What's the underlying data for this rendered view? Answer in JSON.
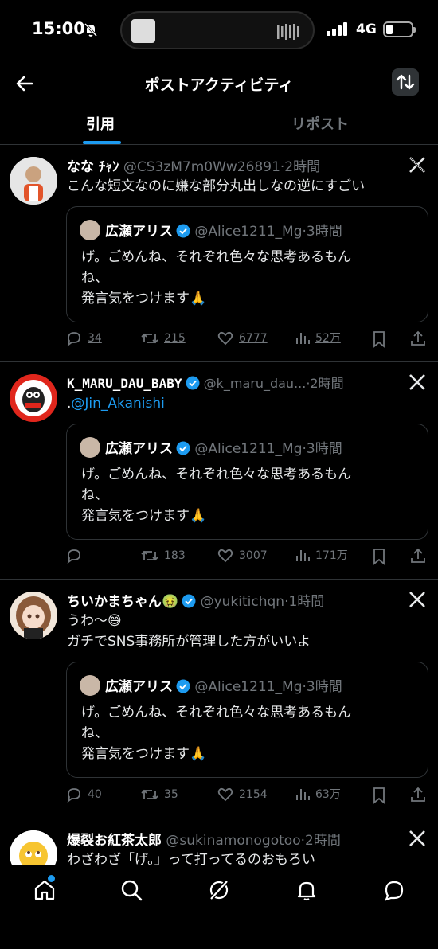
{
  "status": {
    "time": "15:00",
    "network": "4G"
  },
  "header": {
    "title": "ポストアクティビティ"
  },
  "tabs": [
    {
      "label": "引用"
    },
    {
      "label": "リポスト"
    }
  ],
  "quoted": {
    "name": "広瀬アリス",
    "handle": "@Alice1211_Mg",
    "time": "·3時間",
    "text_line1": "げ。ごめんね、それぞれ色々な思考あるもん",
    "text_line2": "ね、",
    "text_line3": "発言気をつけます🙏"
  },
  "posts": [
    {
      "name": "なな ﾁｬﾝ",
      "handle": "@CS3zM7m0Ww26891",
      "time": "·2時間",
      "text": "こんな短文なのに嫌な部分丸出しなの逆にすごい",
      "replies": "34",
      "reposts": "215",
      "likes": "6777",
      "views": "52万"
    },
    {
      "name": "K_MARU_DAU_BABY",
      "handle": "@k_maru_dau...",
      "time": "·2時間",
      "text_prefix": ".",
      "mention": "@Jin_Akanishi",
      "replies": "",
      "reposts": "183",
      "likes": "3007",
      "views": "171万"
    },
    {
      "name": "ちいかまちゃん",
      "name_emoji": "🤢",
      "handle": "@yukitichqn",
      "time": "·1時間",
      "text_line1": "うわ〜😅",
      "text_line2": "ガチでSNS事務所が管理した方がいいよ",
      "replies": "40",
      "reposts": "35",
      "likes": "2154",
      "views": "63万"
    },
    {
      "name": "爆裂お紅茶太郎",
      "handle": "@sukinamonogotoo",
      "time": "·2時間",
      "text": "わざわざ「げ。」って打ってるのおもろい"
    }
  ],
  "colors": {
    "accent": "#1d9bf0",
    "muted": "#71767b",
    "border": "#2f3336"
  }
}
